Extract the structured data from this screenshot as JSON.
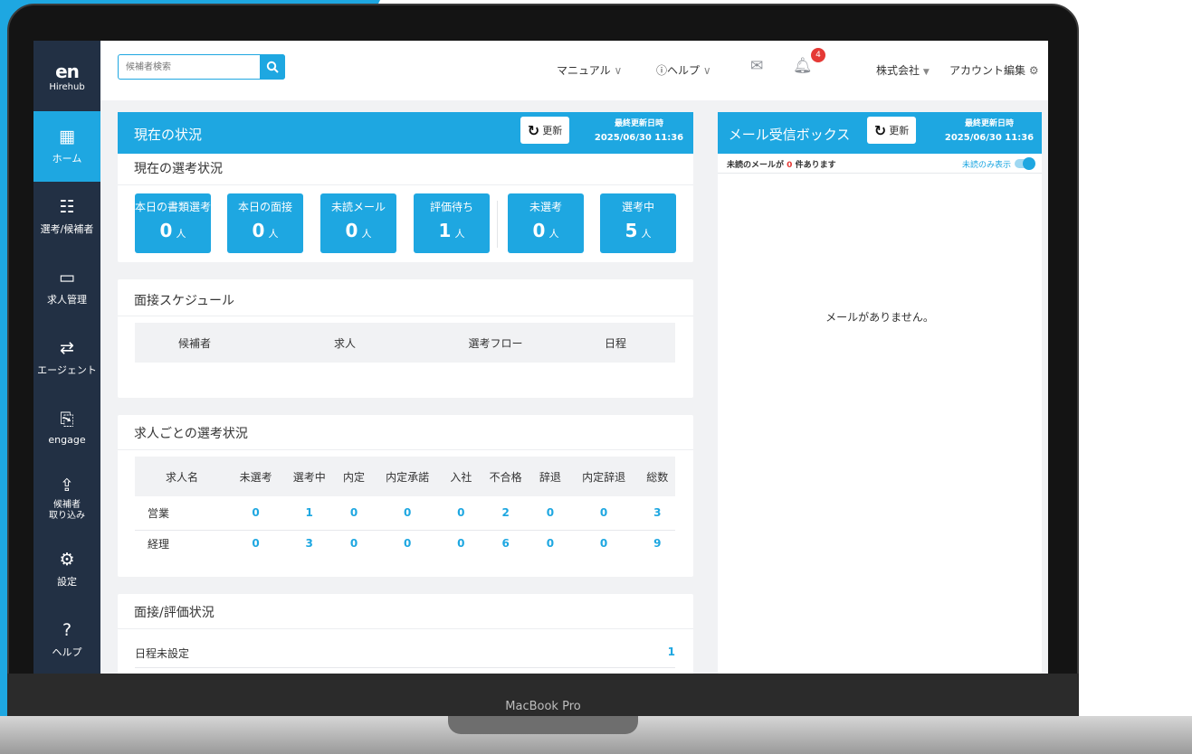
{
  "device_label": "MacBook Pro",
  "logo": {
    "mark": "en",
    "sub": "Hirehub"
  },
  "sidebar": {
    "items": [
      {
        "label": "ホーム",
        "icon": "▦"
      },
      {
        "label": "選考/候補者",
        "icon": "☷"
      },
      {
        "label": "求人管理",
        "icon": "▭"
      },
      {
        "label": "エージェント",
        "icon": "⇄"
      },
      {
        "label": "engage",
        "icon": "⎘"
      },
      {
        "label": "候補者\n取り込み",
        "icon": "⇪"
      },
      {
        "label": "設定",
        "icon": "⚙"
      },
      {
        "label": "ヘルプ",
        "icon": "?"
      }
    ]
  },
  "topbar": {
    "search_placeholder": "候補者検索",
    "manual": "マニュアル",
    "help": "ヘルプ",
    "notification_count": "4",
    "company": "株式会社",
    "account": "アカウント編集"
  },
  "status_panel": {
    "title": "現在の状況",
    "refresh": "更新",
    "updated_label": "最終更新日時",
    "updated_value": "2025/06/30 11:36",
    "section": "現在の選考状況",
    "unit": "人",
    "stats": [
      {
        "label": "本日の書類選考",
        "value": "0"
      },
      {
        "label": "本日の面接",
        "value": "0"
      },
      {
        "label": "未読メール",
        "value": "0"
      },
      {
        "label": "評価待ち",
        "value": "1"
      },
      {
        "label": "未選考",
        "value": "0"
      },
      {
        "label": "選考中",
        "value": "5"
      }
    ]
  },
  "schedule": {
    "title": "面接スケジュール",
    "columns": [
      "候補者",
      "求人",
      "選考フロー",
      "日程"
    ]
  },
  "jobs": {
    "title": "求人ごとの選考状況",
    "columns": [
      "求人名",
      "未選考",
      "選考中",
      "内定",
      "内定承諾",
      "入社",
      "不合格",
      "辞退",
      "内定辞退",
      "総数"
    ],
    "rows": [
      {
        "name": "営業",
        "values": [
          "0",
          "1",
          "0",
          "0",
          "0",
          "2",
          "0",
          "0",
          "3"
        ]
      },
      {
        "name": "経理",
        "values": [
          "0",
          "3",
          "0",
          "0",
          "0",
          "6",
          "0",
          "0",
          "9"
        ]
      }
    ]
  },
  "evaluation": {
    "title": "面接/評価状況",
    "rows": [
      {
        "label": "日程未設定",
        "value": "1"
      }
    ]
  },
  "mailbox": {
    "title": "メール受信ボックス",
    "refresh": "更新",
    "updated_label": "最終更新日時",
    "updated_value": "2025/06/30 11:36",
    "unread_prefix": "未読のメールが",
    "unread_count": "0",
    "unread_suffix": "件あります",
    "toggle_label": "未読のみ表示",
    "empty": "メールがありません。"
  },
  "colors": {
    "accent": "#1ea7e1",
    "sidebar": "#223044",
    "badge": "#e53935"
  }
}
